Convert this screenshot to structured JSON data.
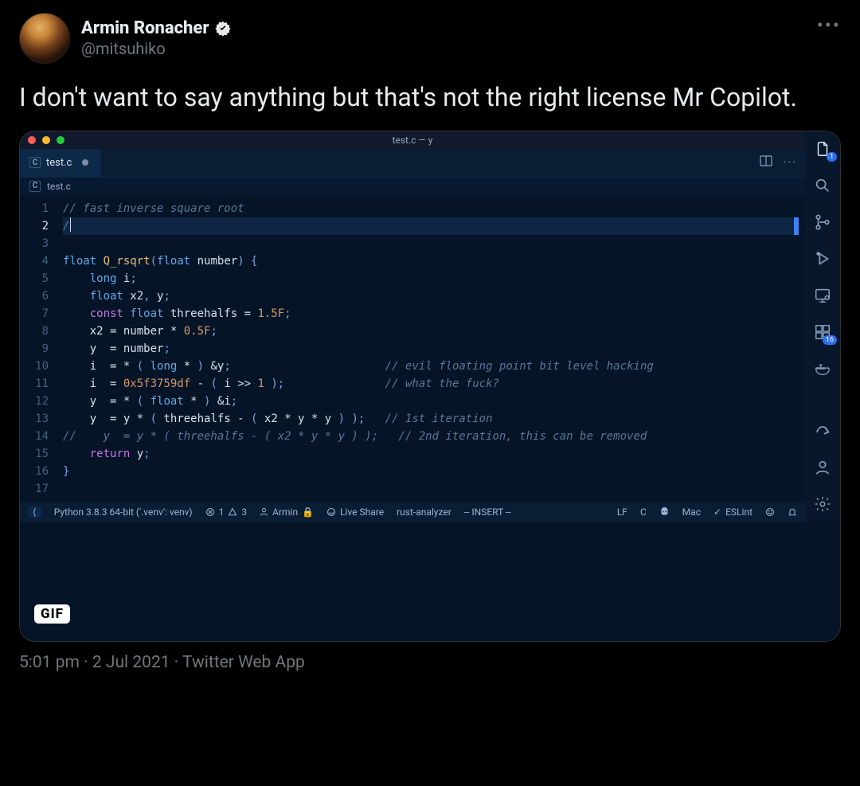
{
  "tweet": {
    "display_name": "Armin Ronacher",
    "handle": "@mitsuhiko",
    "body": "I don't want to say anything but that's not the right license Mr Copilot.",
    "time": "5:01 pm",
    "date": "2 Jul 2021",
    "source": "Twitter Web App",
    "gif_badge": "GIF"
  },
  "editor": {
    "window_title": "test.c — y",
    "tab_label": "test.c",
    "tab_lang_icon": "C",
    "breadcrumb_file": "test.c",
    "breadcrumb_lang_icon": "C",
    "active_line": 2,
    "line_count": 17,
    "code_lines": [
      {
        "n": 1,
        "segments": [
          {
            "cls": "cmnt",
            "t": "// fast inverse square root"
          }
        ]
      },
      {
        "n": 2,
        "segments": [
          {
            "cls": "cmnt",
            "t": "/"
          }
        ],
        "caret": true
      },
      {
        "n": 3,
        "segments": [
          {
            "cls": "id",
            "t": ""
          }
        ]
      },
      {
        "n": 4,
        "segments": [
          {
            "cls": "type",
            "t": "float "
          },
          {
            "cls": "fn",
            "t": "Q_rsqrt"
          },
          {
            "cls": "p",
            "t": "("
          },
          {
            "cls": "type",
            "t": "float "
          },
          {
            "cls": "id",
            "t": "number"
          },
          {
            "cls": "p",
            "t": ") {"
          }
        ]
      },
      {
        "n": 5,
        "segments": [
          {
            "cls": "id",
            "t": "    "
          },
          {
            "cls": "type",
            "t": "long "
          },
          {
            "cls": "id",
            "t": "i"
          },
          {
            "cls": "p",
            "t": ";"
          }
        ]
      },
      {
        "n": 6,
        "segments": [
          {
            "cls": "id",
            "t": "    "
          },
          {
            "cls": "type",
            "t": "float "
          },
          {
            "cls": "id",
            "t": "x2"
          },
          {
            "cls": "p",
            "t": ", "
          },
          {
            "cls": "id",
            "t": "y"
          },
          {
            "cls": "p",
            "t": ";"
          }
        ]
      },
      {
        "n": 7,
        "segments": [
          {
            "cls": "id",
            "t": "    "
          },
          {
            "cls": "kw",
            "t": "const "
          },
          {
            "cls": "type",
            "t": "float "
          },
          {
            "cls": "id",
            "t": "threehalfs "
          },
          {
            "cls": "op",
            "t": "= "
          },
          {
            "cls": "num",
            "t": "1.5F"
          },
          {
            "cls": "p",
            "t": ";"
          }
        ]
      },
      {
        "n": 8,
        "segments": [
          {
            "cls": "id",
            "t": "    x2 "
          },
          {
            "cls": "op",
            "t": "= "
          },
          {
            "cls": "id",
            "t": "number "
          },
          {
            "cls": "op",
            "t": "* "
          },
          {
            "cls": "num",
            "t": "0.5F"
          },
          {
            "cls": "p",
            "t": ";"
          }
        ]
      },
      {
        "n": 9,
        "segments": [
          {
            "cls": "id",
            "t": "    y  "
          },
          {
            "cls": "op",
            "t": "= "
          },
          {
            "cls": "id",
            "t": "number"
          },
          {
            "cls": "p",
            "t": ";"
          }
        ]
      },
      {
        "n": 10,
        "segments": [
          {
            "cls": "id",
            "t": "    i  "
          },
          {
            "cls": "op",
            "t": "= * "
          },
          {
            "cls": "p",
            "t": "( "
          },
          {
            "cls": "type",
            "t": "long "
          },
          {
            "cls": "op",
            "t": "* "
          },
          {
            "cls": "p",
            "t": ") "
          },
          {
            "cls": "op",
            "t": "&"
          },
          {
            "cls": "id",
            "t": "y"
          },
          {
            "cls": "p",
            "t": ";"
          },
          {
            "cls": "id",
            "t": "                       "
          },
          {
            "cls": "cmnt",
            "t": "// evil floating point bit level hacking"
          }
        ]
      },
      {
        "n": 11,
        "segments": [
          {
            "cls": "id",
            "t": "    i  "
          },
          {
            "cls": "op",
            "t": "= "
          },
          {
            "cls": "num",
            "t": "0x5f3759df"
          },
          {
            "cls": "op",
            "t": " - "
          },
          {
            "cls": "p",
            "t": "( "
          },
          {
            "cls": "id",
            "t": "i "
          },
          {
            "cls": "op",
            "t": ">> "
          },
          {
            "cls": "num",
            "t": "1"
          },
          {
            "cls": "p",
            "t": " );"
          },
          {
            "cls": "id",
            "t": "               "
          },
          {
            "cls": "cmnt",
            "t": "// what the fuck?"
          }
        ]
      },
      {
        "n": 12,
        "segments": [
          {
            "cls": "id",
            "t": "    y  "
          },
          {
            "cls": "op",
            "t": "= * "
          },
          {
            "cls": "p",
            "t": "( "
          },
          {
            "cls": "type",
            "t": "float "
          },
          {
            "cls": "op",
            "t": "* "
          },
          {
            "cls": "p",
            "t": ") "
          },
          {
            "cls": "op",
            "t": "&"
          },
          {
            "cls": "id",
            "t": "i"
          },
          {
            "cls": "p",
            "t": ";"
          }
        ]
      },
      {
        "n": 13,
        "segments": [
          {
            "cls": "id",
            "t": "    y  "
          },
          {
            "cls": "op",
            "t": "= "
          },
          {
            "cls": "id",
            "t": "y "
          },
          {
            "cls": "op",
            "t": "* "
          },
          {
            "cls": "p",
            "t": "( "
          },
          {
            "cls": "id",
            "t": "threehalfs "
          },
          {
            "cls": "op",
            "t": "- "
          },
          {
            "cls": "p",
            "t": "( "
          },
          {
            "cls": "id",
            "t": "x2 "
          },
          {
            "cls": "op",
            "t": "* "
          },
          {
            "cls": "id",
            "t": "y "
          },
          {
            "cls": "op",
            "t": "* "
          },
          {
            "cls": "id",
            "t": "y "
          },
          {
            "cls": "p",
            "t": ") );"
          },
          {
            "cls": "id",
            "t": "   "
          },
          {
            "cls": "cmnt",
            "t": "// 1st iteration"
          }
        ]
      },
      {
        "n": 14,
        "segments": [
          {
            "cls": "cmnt",
            "t": "//    y  = y * ( threehalfs - ( x2 * y * y ) );   // 2nd iteration, this can be removed"
          }
        ]
      },
      {
        "n": 15,
        "segments": [
          {
            "cls": "id",
            "t": "    "
          },
          {
            "cls": "kw",
            "t": "return "
          },
          {
            "cls": "id",
            "t": "y"
          },
          {
            "cls": "p",
            "t": ";"
          }
        ]
      },
      {
        "n": 16,
        "segments": [
          {
            "cls": "p",
            "t": "}"
          }
        ]
      },
      {
        "n": 17,
        "segments": [
          {
            "cls": "id",
            "t": ""
          }
        ]
      }
    ],
    "activity": {
      "items": [
        {
          "name": "files-icon",
          "badge": "1",
          "active": true
        },
        {
          "name": "search-icon"
        },
        {
          "name": "source-control-icon"
        },
        {
          "name": "debug-icon"
        },
        {
          "name": "remote-explorer-icon"
        },
        {
          "name": "extensions-icon",
          "badge": "16"
        },
        {
          "name": "docker-icon"
        }
      ],
      "bottom": [
        {
          "name": "share-icon"
        },
        {
          "name": "account-icon"
        },
        {
          "name": "settings-gear-icon"
        }
      ]
    },
    "statusbar": {
      "remote_label": "⟨",
      "python": "Python 3.8.3 64-bit ('.venv': venv)",
      "errors": "1",
      "warnings": "3",
      "user": "Armin",
      "liveshare": "Live Share",
      "rust": "rust-analyzer",
      "mode": "-- INSERT --",
      "eol": "LF",
      "lang": "C",
      "platform": "Mac",
      "eslint": "ESLint"
    }
  }
}
